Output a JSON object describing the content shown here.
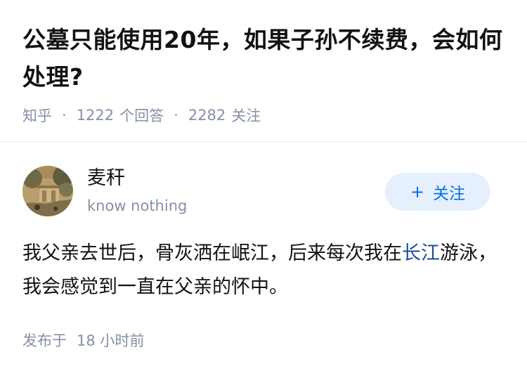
{
  "question": {
    "title": "公墓只能使用20年，如果子孙不续费，会如何处理?",
    "source": "知乎",
    "answer_count": "1222",
    "answer_label": "个回答",
    "follower_count": "2282",
    "follower_label": "关注",
    "separator": "·"
  },
  "answer": {
    "author": {
      "name": "麦秆",
      "bio": "know nothing",
      "avatar_icon": "landscape-painting-avatar"
    },
    "follow_button": {
      "icon": "+",
      "label": "关注"
    },
    "content": {
      "before_link": "我父亲去世后，骨灰洒在岷江，后来每次我在",
      "link": "长江",
      "after_link": "游泳，我会感觉到一直在父亲的怀中。"
    },
    "time": {
      "label": "发布于",
      "value": "18 小时前"
    }
  },
  "colors": {
    "title": "#121212",
    "meta": "#8590a6",
    "link": "#175199",
    "follow_bg": "#e6f0fd",
    "follow_text": "#056de8",
    "divider": "#ebebeb"
  }
}
